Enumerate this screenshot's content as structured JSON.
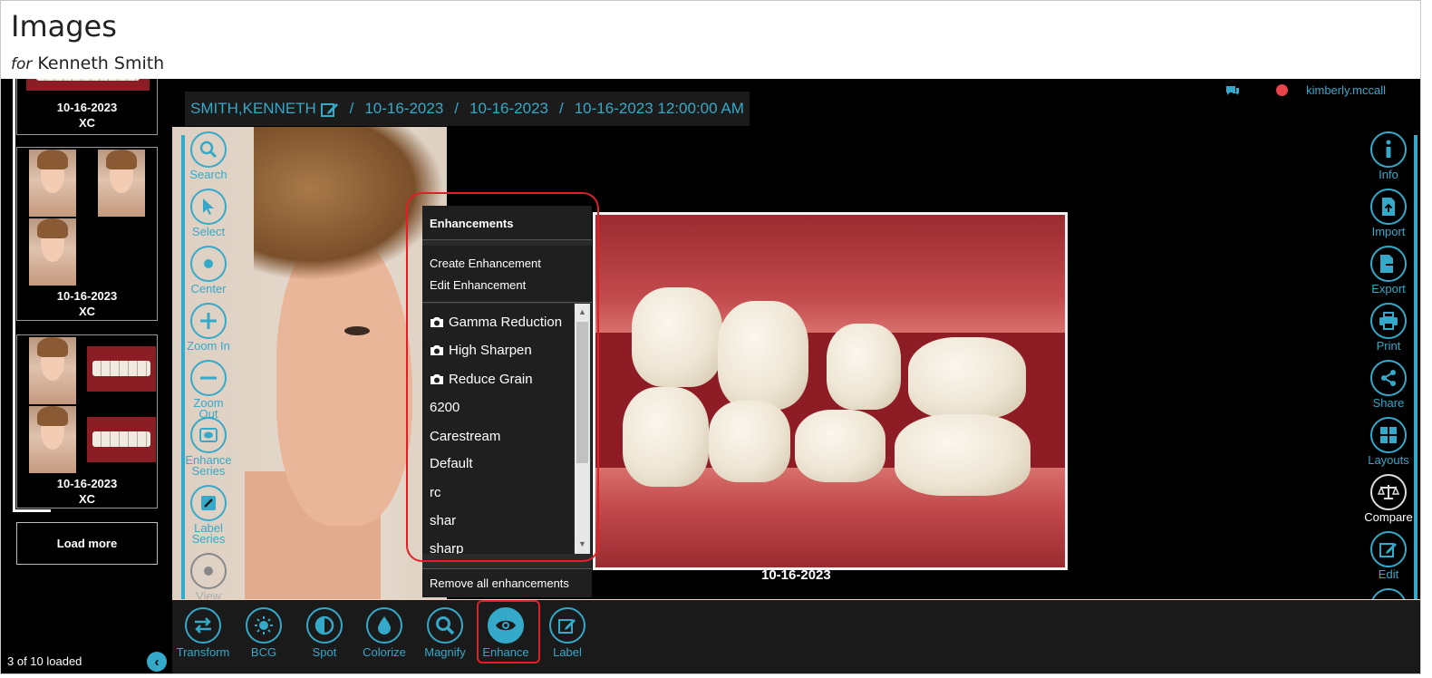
{
  "header": {
    "title": "Images",
    "subtitle_prefix": "for",
    "patient_name": "Kenneth Smith"
  },
  "thumbnails": {
    "cards": [
      {
        "date": "10-16-2023",
        "modality": "XC"
      },
      {
        "date": "10-16-2023",
        "modality": "XC"
      },
      {
        "date": "10-16-2023",
        "modality": "XC"
      }
    ],
    "load_more": "Load more",
    "loaded_count": "3 of 10 loaded"
  },
  "breadcrumb": {
    "patient": "SMITH,KENNETH",
    "sep": "/",
    "date1": "10-16-2023",
    "date2": "10-16-2023",
    "datetime": "10-16-2023 12:00:00 AM"
  },
  "user": {
    "name": "kimberly.mccall",
    "status_color": "#e8424a"
  },
  "left_tools": [
    {
      "label": "Search",
      "icon": "search-icon"
    },
    {
      "label": "Select",
      "icon": "cursor-icon"
    },
    {
      "label": "Center",
      "icon": "center-icon"
    },
    {
      "label": "Zoom In",
      "icon": "zoom-in-icon"
    },
    {
      "label": "Zoom Out",
      "icon": "zoom-out-icon"
    },
    {
      "label": "Enhance Series",
      "icon": "enhance-series-icon"
    },
    {
      "label": "Label Series",
      "icon": "label-series-icon"
    },
    {
      "label": "View",
      "icon": "view-icon"
    }
  ],
  "right_tools": [
    {
      "label": "Info",
      "icon": "info-icon"
    },
    {
      "label": "Import",
      "icon": "import-icon"
    },
    {
      "label": "Export",
      "icon": "export-icon"
    },
    {
      "label": "Print",
      "icon": "print-icon"
    },
    {
      "label": "Share",
      "icon": "share-icon"
    },
    {
      "label": "Layouts",
      "icon": "layouts-icon"
    },
    {
      "label": "Compare",
      "icon": "compare-icon"
    },
    {
      "label": "Edit",
      "icon": "edit-icon"
    }
  ],
  "image_date": "10-16-2023",
  "enhancements_menu": {
    "title": "Enhancements",
    "create": "Create Enhancement",
    "edit": "Edit Enhancement",
    "items": [
      {
        "label": "Gamma Reduction",
        "has_camera": true
      },
      {
        "label": "High Sharpen",
        "has_camera": true
      },
      {
        "label": "Reduce Grain",
        "has_camera": true
      },
      {
        "label": "6200",
        "has_camera": false
      },
      {
        "label": "Carestream",
        "has_camera": false
      },
      {
        "label": "Default",
        "has_camera": false
      },
      {
        "label": "rc",
        "has_camera": false
      },
      {
        "label": "shar",
        "has_camera": false
      },
      {
        "label": "sharp",
        "has_camera": false
      }
    ],
    "remove_all": "Remove all enhancements"
  },
  "bottom_tools": [
    {
      "label": "Transform",
      "icon": "transform-icon"
    },
    {
      "label": "BCG",
      "icon": "bcg-icon"
    },
    {
      "label": "Spot",
      "icon": "spot-icon"
    },
    {
      "label": "Colorize",
      "icon": "colorize-icon"
    },
    {
      "label": "Magnify",
      "icon": "magnify-icon"
    },
    {
      "label": "Enhance",
      "icon": "eye-icon",
      "active": true
    },
    {
      "label": "Label",
      "icon": "label-icon"
    }
  ],
  "colors": {
    "accent": "#35a9c9",
    "highlight": "#e01f26"
  }
}
